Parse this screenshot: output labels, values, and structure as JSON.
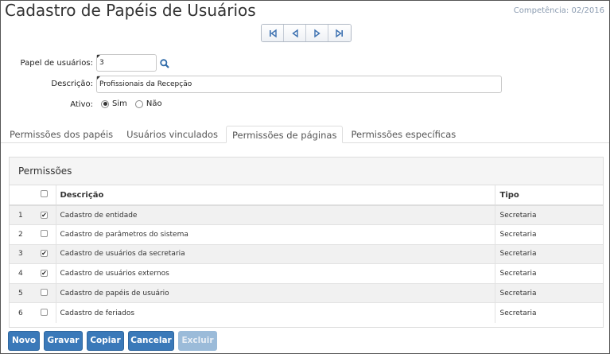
{
  "header": {
    "title": "Cadastro de Papéis de Usuários",
    "competencia": "Competência: 02/2016"
  },
  "navigation": {
    "buttons": [
      "first-icon",
      "previous-icon",
      "next-icon",
      "last-icon"
    ]
  },
  "form": {
    "papel_label": "Papel de usuários:",
    "papel_value": "3",
    "descricao_label": "Descrição:",
    "descricao_value": "Profissionais da Recepção",
    "ativo_label": "Ativo:",
    "ativo_options": [
      {
        "label": "Sim",
        "selected": true
      },
      {
        "label": "Não",
        "selected": false
      }
    ]
  },
  "tabs": [
    {
      "label": "Permissões dos papéis",
      "active": false
    },
    {
      "label": "Usuários vinculados",
      "active": false
    },
    {
      "label": "Permissões de páginas",
      "active": true
    },
    {
      "label": "Permissões específicas",
      "active": false
    }
  ],
  "permissions": {
    "title": "Permissões",
    "columns": {
      "descricao": "Descrição",
      "tipo": "Tipo"
    },
    "rows": [
      {
        "num": "1",
        "checked": true,
        "descricao": "Cadastro de entidade",
        "tipo": "Secretaria"
      },
      {
        "num": "2",
        "checked": false,
        "descricao": "Cadastro de parâmetros do sistema",
        "tipo": "Secretaria"
      },
      {
        "num": "3",
        "checked": true,
        "descricao": "Cadastro de usuários da secretaria",
        "tipo": "Secretaria"
      },
      {
        "num": "4",
        "checked": true,
        "descricao": "Cadastro de usuários externos",
        "tipo": "Secretaria"
      },
      {
        "num": "5",
        "checked": false,
        "descricao": "Cadastro de papéis de usuário",
        "tipo": "Secretaria"
      },
      {
        "num": "6",
        "checked": false,
        "descricao": "Cadastro de feriados",
        "tipo": "Secretaria"
      }
    ]
  },
  "toolbar": {
    "novo": "Novo",
    "gravar": "Gravar",
    "copiar": "Copiar",
    "cancelar": "Cancelar",
    "excluir": "Excluir"
  },
  "colors": {
    "button_primary": "#3a79b9",
    "button_disabled": "#9bbbd9"
  }
}
